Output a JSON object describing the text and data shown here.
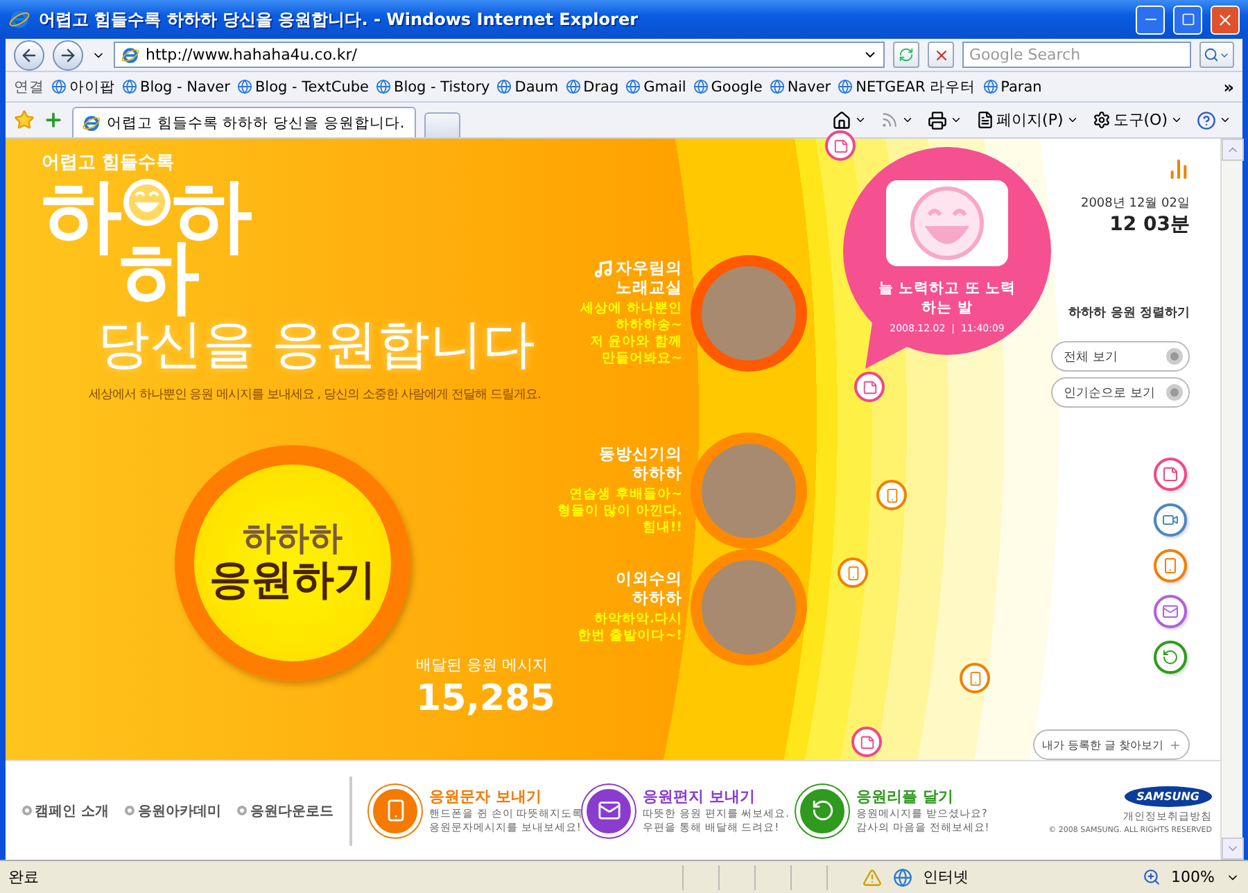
{
  "window": {
    "title": "어렵고 힘들수록 하하하 당신을 응원합니다. - Windows Internet Explorer"
  },
  "address_bar": {
    "url": "http://www.hahaha4u.co.kr/",
    "search_placeholder": "Google Search"
  },
  "links_bar": {
    "label": "연결",
    "links": [
      "아이팝",
      "Blog - Naver",
      "Blog - TextCube",
      "Blog - Tistory",
      "Daum",
      "Drag",
      "Gmail",
      "Google",
      "Naver",
      "NETGEAR 라우터",
      "Paran"
    ],
    "more": "»"
  },
  "tab": {
    "title": "어렵고 힘들수록 하하하 당신을 응원합니다."
  },
  "command_bar": {
    "page_menu": "페이지(P)",
    "tools_menu": "도구(O)"
  },
  "hero": {
    "tagline": "어렵고 힘들수록",
    "logo_letters": [
      "하",
      "하",
      "하"
    ],
    "headline": "당신을 응원합니다",
    "subtitle": "세상에서 하나뿐인 응원 메시지를 보내세요 , 당신의 소중한 사람에게 전달해 드릴게요.",
    "cta": {
      "top": "하하하",
      "bottom": "응원하기"
    },
    "counter": {
      "label": "배달된 응원 메시지",
      "value": "15,285"
    }
  },
  "celebrities": [
    {
      "kind": "song",
      "title_lines": [
        "자우림의",
        "노래교실"
      ],
      "message_lines": [
        "세상에 하나뿐인",
        "하하하송~",
        "저 윤아와 함께",
        "만들어봐요~"
      ]
    },
    {
      "kind": "talk",
      "title_lines": [
        "동방신기의",
        "하하하"
      ],
      "message_lines": [
        "연습생 후배들아~",
        "형들이 많이 아낀다.",
        "힘내!!"
      ]
    },
    {
      "kind": "talk",
      "title_lines": [
        "이외수의",
        "하하하"
      ],
      "message_lines": [
        "하악하악.다시",
        "한번 출발이다~!"
      ]
    }
  ],
  "bubble": {
    "message_lines": [
      "늘 노력하고 또 노력",
      "하는 발"
    ],
    "timestamp": "2008.12.02  |  11:40:09"
  },
  "side_panel": {
    "date": "2008년 12월 02일",
    "time": "12 03분",
    "sort_title": "하하하 응원 정렬하기",
    "sort_buttons": [
      "전체 보기",
      "인기순으로 보기"
    ],
    "my_posts_button": "내가 등록한 글 찾아보기"
  },
  "footer": {
    "nav_links": [
      "캠페인 소개",
      "응원아카데미",
      "응원다운로드"
    ],
    "features": [
      {
        "kind": "sms",
        "title": "응원문자 보내기",
        "color": "#f47a00",
        "lines": [
          "핸드폰을 쥔 손이 따뜻해지도록",
          "응원문자메시지를 보내보세요!"
        ]
      },
      {
        "kind": "letter",
        "title": "응원편지 보내기",
        "color": "#8a3ccf",
        "lines": [
          "따뜻한 응원 편지를 써보세요.",
          "우편을 통해 배달해 드려요!"
        ]
      },
      {
        "kind": "reply",
        "title": "응원리플 달기",
        "color": "#2f9a1e",
        "lines": [
          "응원메시지를 받으셨나요?",
          "감사의 마음을 전해보세요!"
        ]
      }
    ],
    "brand": "SAMSUNG",
    "privacy_link": "개인정보취급방침",
    "copyright": "© 2008 SAMSUNG. ALL RIGHTS RESERVED"
  },
  "status_bar": {
    "status": "완료",
    "zone": "인터넷",
    "zoom": "100%"
  }
}
